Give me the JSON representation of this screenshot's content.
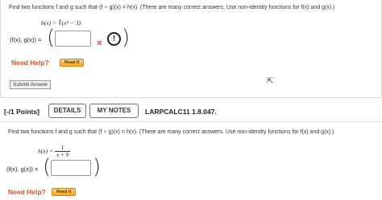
{
  "problem1": {
    "prompt": "Find two functions f and g such that (f ∘ g)(x) = h(x). (There are many correct answers. Use non-identity functions for f(x) and g(x).)",
    "h_label": "h(x) =",
    "h_expr": "∛(x² − 3)",
    "pair_label": "(f(x), g(x)) =",
    "answer_value": "",
    "status": "incorrect",
    "need_help": "Need Help?",
    "read_it": "Read It",
    "submit": "Submit Answer"
  },
  "problem2": {
    "points": "[-/1 Points]",
    "details": "DETAILS",
    "my_notes": "MY NOTES",
    "id": "LARPCALC11 1.8.047.",
    "prompt": "Find two functions f and g such that (f ∘ g)(x) = h(x). (There are many correct answers. Use non-identity functions for f(x) and g(x).)",
    "h_label": "h(x) =",
    "h_num": "1",
    "h_den": "x + 9",
    "pair_label": "(f(x), g(x)) =",
    "answer_value": "",
    "need_help": "Need Help?",
    "read_it": "Read It"
  }
}
